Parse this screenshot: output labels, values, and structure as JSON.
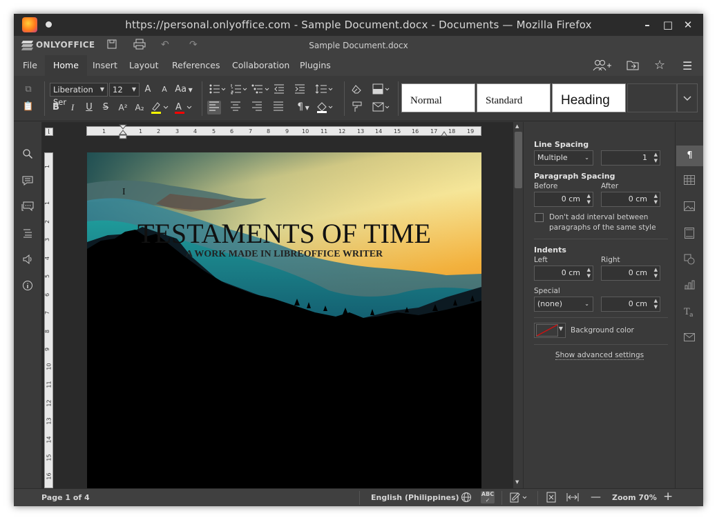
{
  "browser": {
    "title": "https://personal.onlyoffice.com - Sample Document.docx - Documents — Mozilla Firefox",
    "window_controls": {
      "minimize": "–",
      "maximize": "□",
      "close": "✕"
    }
  },
  "app": {
    "logo": "ONLYOFFICE",
    "document_title": "Sample Document.docx"
  },
  "menu": {
    "tabs": [
      "File",
      "Home",
      "Insert",
      "Layout",
      "References",
      "Collaboration",
      "Plugins"
    ],
    "active": "Home"
  },
  "toolbar": {
    "font_name": "Liberation Ser",
    "font_size": "12",
    "styles": [
      "Normal",
      "Standard",
      "Heading"
    ],
    "aa_label": "Aa",
    "font_grow": "A",
    "font_shrink": "A",
    "bold": "B",
    "italic": "I",
    "underline": "U",
    "strike": "S",
    "superscript": "A²",
    "subscript": "A₂",
    "highlight_color": "#ffff00",
    "font_color": "#ff0000"
  },
  "ruler": {
    "h_ticks": [
      "1",
      "1",
      "2",
      "3",
      "4",
      "5",
      "6",
      "7",
      "8",
      "9",
      "10",
      "11",
      "12",
      "13",
      "14",
      "15",
      "16",
      "17",
      "18",
      "19"
    ],
    "v_ticks": [
      "1",
      "1",
      "2",
      "3",
      "4",
      "5",
      "6",
      "7",
      "8",
      "9",
      "10",
      "11",
      "12",
      "13",
      "14",
      "15",
      "16"
    ]
  },
  "document": {
    "title": "TESTAMENTS OF TIME",
    "subtitle": "A WORK MADE IN LIBREOFFICE WRITER",
    "cursor": "I"
  },
  "paragraph_panel": {
    "line_spacing_label": "Line Spacing",
    "line_spacing_mode": "Multiple",
    "line_spacing_value": "1",
    "paragraph_spacing_label": "Paragraph Spacing",
    "before_label": "Before",
    "before_value": "0 cm",
    "after_label": "After",
    "after_value": "0 cm",
    "dont_add_interval": "Don't add interval between paragraphs of the same style",
    "indents_label": "Indents",
    "left_label": "Left",
    "left_value": "0 cm",
    "right_label": "Right",
    "right_value": "0 cm",
    "special_label": "Special",
    "special_mode": "(none)",
    "special_value": "0 cm",
    "background_color_label": "Background color",
    "advanced_link": "Show advanced settings"
  },
  "status": {
    "page": "Page 1 of 4",
    "language": "English (Philippines)",
    "zoom": "Zoom 70%"
  }
}
